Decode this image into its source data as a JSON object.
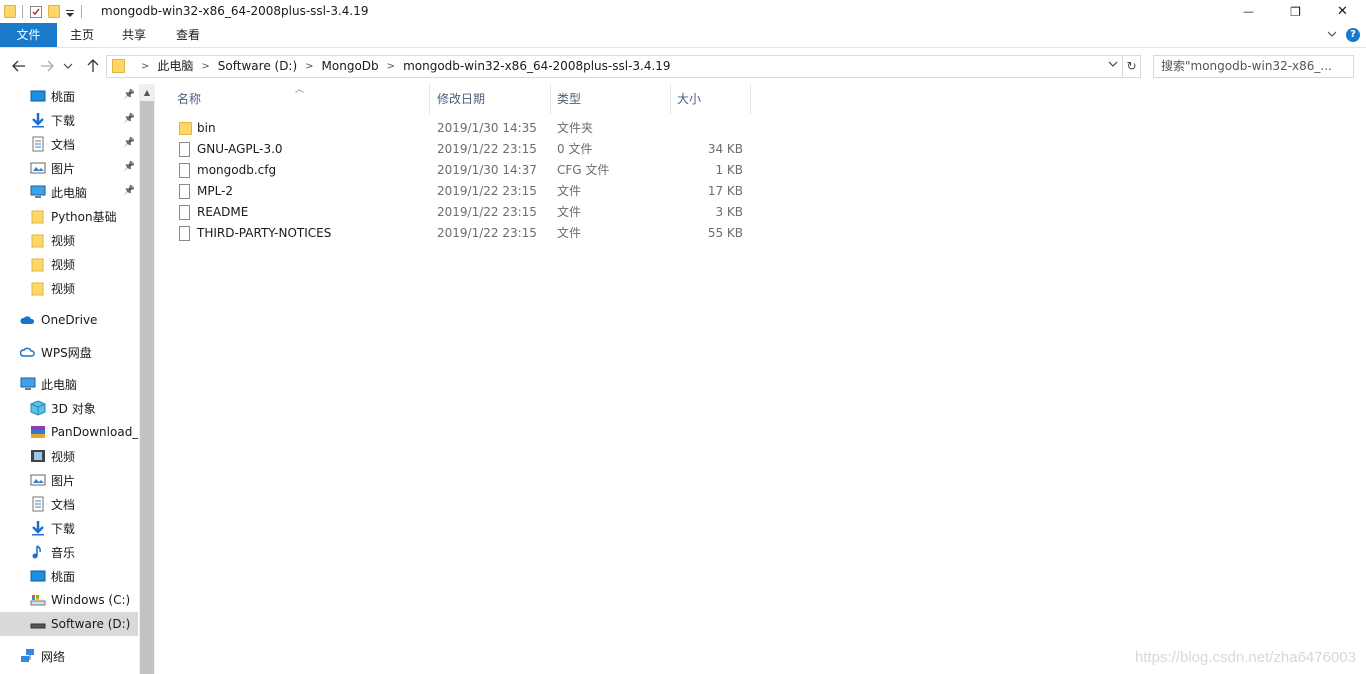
{
  "window": {
    "title": "mongodb-win32-x86_64-2008plus-ssl-3.4.19",
    "minimize_glyph": "—",
    "restore_glyph": "❐",
    "close_glyph": "✕"
  },
  "ribbon": {
    "tabs": [
      {
        "label": "文件"
      },
      {
        "label": "主页"
      },
      {
        "label": "共享"
      },
      {
        "label": "查看"
      }
    ]
  },
  "address": {
    "breadcrumbs": [
      "此电脑",
      "Software (D:)",
      "MongoDb",
      "mongodb-win32-x86_64-2008plus-ssl-3.4.19"
    ],
    "search_placeholder": "搜索\"mongodb-win32-x86_..."
  },
  "sidebar": {
    "items": [
      {
        "label": "桃面",
        "icon": "desktop-icon",
        "pinned": true
      },
      {
        "label": "下载",
        "icon": "download-icon",
        "pinned": true
      },
      {
        "label": "文档",
        "icon": "document-icon",
        "pinned": true
      },
      {
        "label": "图片",
        "icon": "pictures-icon",
        "pinned": true
      },
      {
        "label": "此电脑",
        "icon": "computer-icon",
        "pinned": true
      },
      {
        "label": "Python基础",
        "icon": "folder-icon",
        "pinned": false
      },
      {
        "label": "视频",
        "icon": "folder-icon",
        "pinned": false
      },
      {
        "label": "视频",
        "icon": "folder-icon",
        "pinned": false
      },
      {
        "label": "视频",
        "icon": "folder-icon",
        "pinned": false
      },
      {
        "label": "OneDrive",
        "icon": "onedrive-icon",
        "pinned": false
      },
      {
        "label": "WPS网盘",
        "icon": "wps-cloud-icon",
        "pinned": false
      },
      {
        "label": "此电脑",
        "icon": "computer-icon",
        "pinned": false
      },
      {
        "label": "3D 对象",
        "icon": "3d-objects-icon",
        "pinned": false
      },
      {
        "label": "PanDownload_",
        "icon": "archive-icon",
        "pinned": false
      },
      {
        "label": "视频",
        "icon": "videos-icon",
        "pinned": false
      },
      {
        "label": "图片",
        "icon": "pictures-icon",
        "pinned": false
      },
      {
        "label": "文档",
        "icon": "document-icon",
        "pinned": false
      },
      {
        "label": "下载",
        "icon": "download-icon",
        "pinned": false
      },
      {
        "label": "音乐",
        "icon": "music-icon",
        "pinned": false
      },
      {
        "label": "桃面",
        "icon": "desktop-icon",
        "pinned": false
      },
      {
        "label": "Windows (C:)",
        "icon": "drive-c-icon",
        "pinned": false
      },
      {
        "label": "Software (D:)",
        "icon": "drive-d-icon",
        "pinned": false,
        "selected": true
      },
      {
        "label": "网络",
        "icon": "network-icon",
        "pinned": false
      }
    ]
  },
  "columns": {
    "name": "名称",
    "modified": "修改日期",
    "type": "类型",
    "size": "大小"
  },
  "files": [
    {
      "name": "bin",
      "modified": "2019/1/30 14:35",
      "type": "文件夹",
      "size": "",
      "icon": "folder-icon"
    },
    {
      "name": "GNU-AGPL-3.0",
      "modified": "2019/1/22 23:15",
      "type": "0 文件",
      "size": "34 KB",
      "icon": "file-icon"
    },
    {
      "name": "mongodb.cfg",
      "modified": "2019/1/30 14:37",
      "type": "CFG 文件",
      "size": "1 KB",
      "icon": "file-icon"
    },
    {
      "name": "MPL-2",
      "modified": "2019/1/22 23:15",
      "type": "文件",
      "size": "17 KB",
      "icon": "file-icon"
    },
    {
      "name": "README",
      "modified": "2019/1/22 23:15",
      "type": "文件",
      "size": "3 KB",
      "icon": "file-icon"
    },
    {
      "name": "THIRD-PARTY-NOTICES",
      "modified": "2019/1/22 23:15",
      "type": "文件",
      "size": "55 KB",
      "icon": "file-icon"
    }
  ],
  "watermark": "https://blog.csdn.net/zha6476003"
}
